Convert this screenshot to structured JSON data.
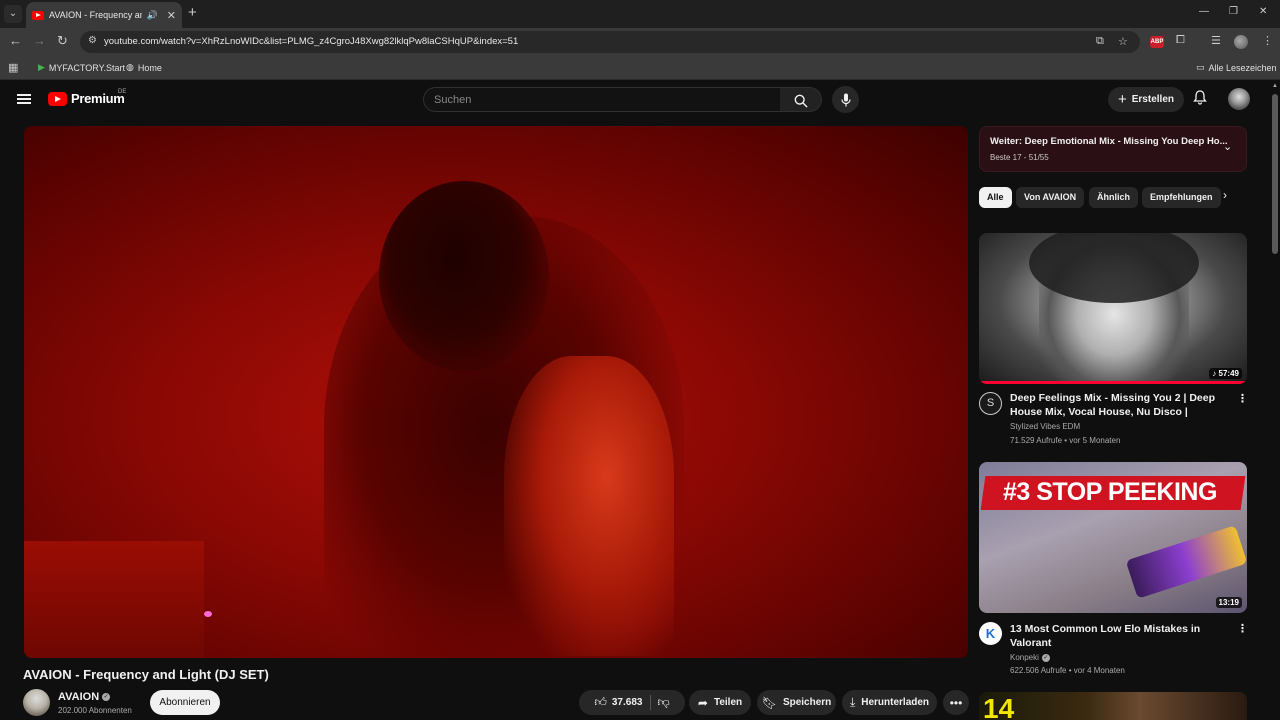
{
  "browser": {
    "tab_title": "AVAION - Frequency and Li",
    "url": "youtube.com/watch?v=XhRzLnoWIDc&list=PLMG_z4CgroJ48Xwg82lklqPw8laCSHqUP&index=51",
    "bookmarks": [
      {
        "label": "MYFACTORY.Start"
      },
      {
        "label": "Home"
      }
    ],
    "all_bookmarks": "Alle Lesezeichen"
  },
  "yt": {
    "logo_text": "Premium",
    "country": "DE",
    "search_placeholder": "Suchen",
    "create_label": "Erstellen"
  },
  "video": {
    "title": "AVAION - Frequency and Light (DJ SET)",
    "channel": "AVAION",
    "subscribers": "202.000 Abonnenten",
    "subscribe_label": "Abonnieren",
    "likes": "37.683",
    "share_label": "Teilen",
    "save_label": "Speichern",
    "download_label": "Herunterladen"
  },
  "playlist": {
    "title": "Weiter: Deep Emotional Mix - Missing You Deep Ho...",
    "subtitle": "Beste 17 - 51/55"
  },
  "chips": [
    "Alle",
    "Von AVAION",
    "Ähnlich",
    "Empfehlungen"
  ],
  "recommendations": [
    {
      "title": "Deep Feelings Mix - Missing You 2 | Deep House Mix, Vocal House, Nu Disco | Intimate...",
      "channel": "Stylized Vibes EDM",
      "meta": "71.529 Aufrufe • vor 5 Monaten",
      "duration": "57:49",
      "watched_fraction": 1.0
    },
    {
      "title": "13 Most Common Low Elo Mistakes in Valorant",
      "channel": "Konpeki",
      "meta": "622.506 Aufrufe • vor 4 Monaten",
      "duration": "13:19",
      "thumb_text": "#3 STOP PEEKING"
    },
    {
      "thumb_text": "14"
    }
  ],
  "colors": {
    "accent": "#ff0000",
    "background": "#0f0f0f",
    "playlist_bg": "#2a0f14"
  }
}
